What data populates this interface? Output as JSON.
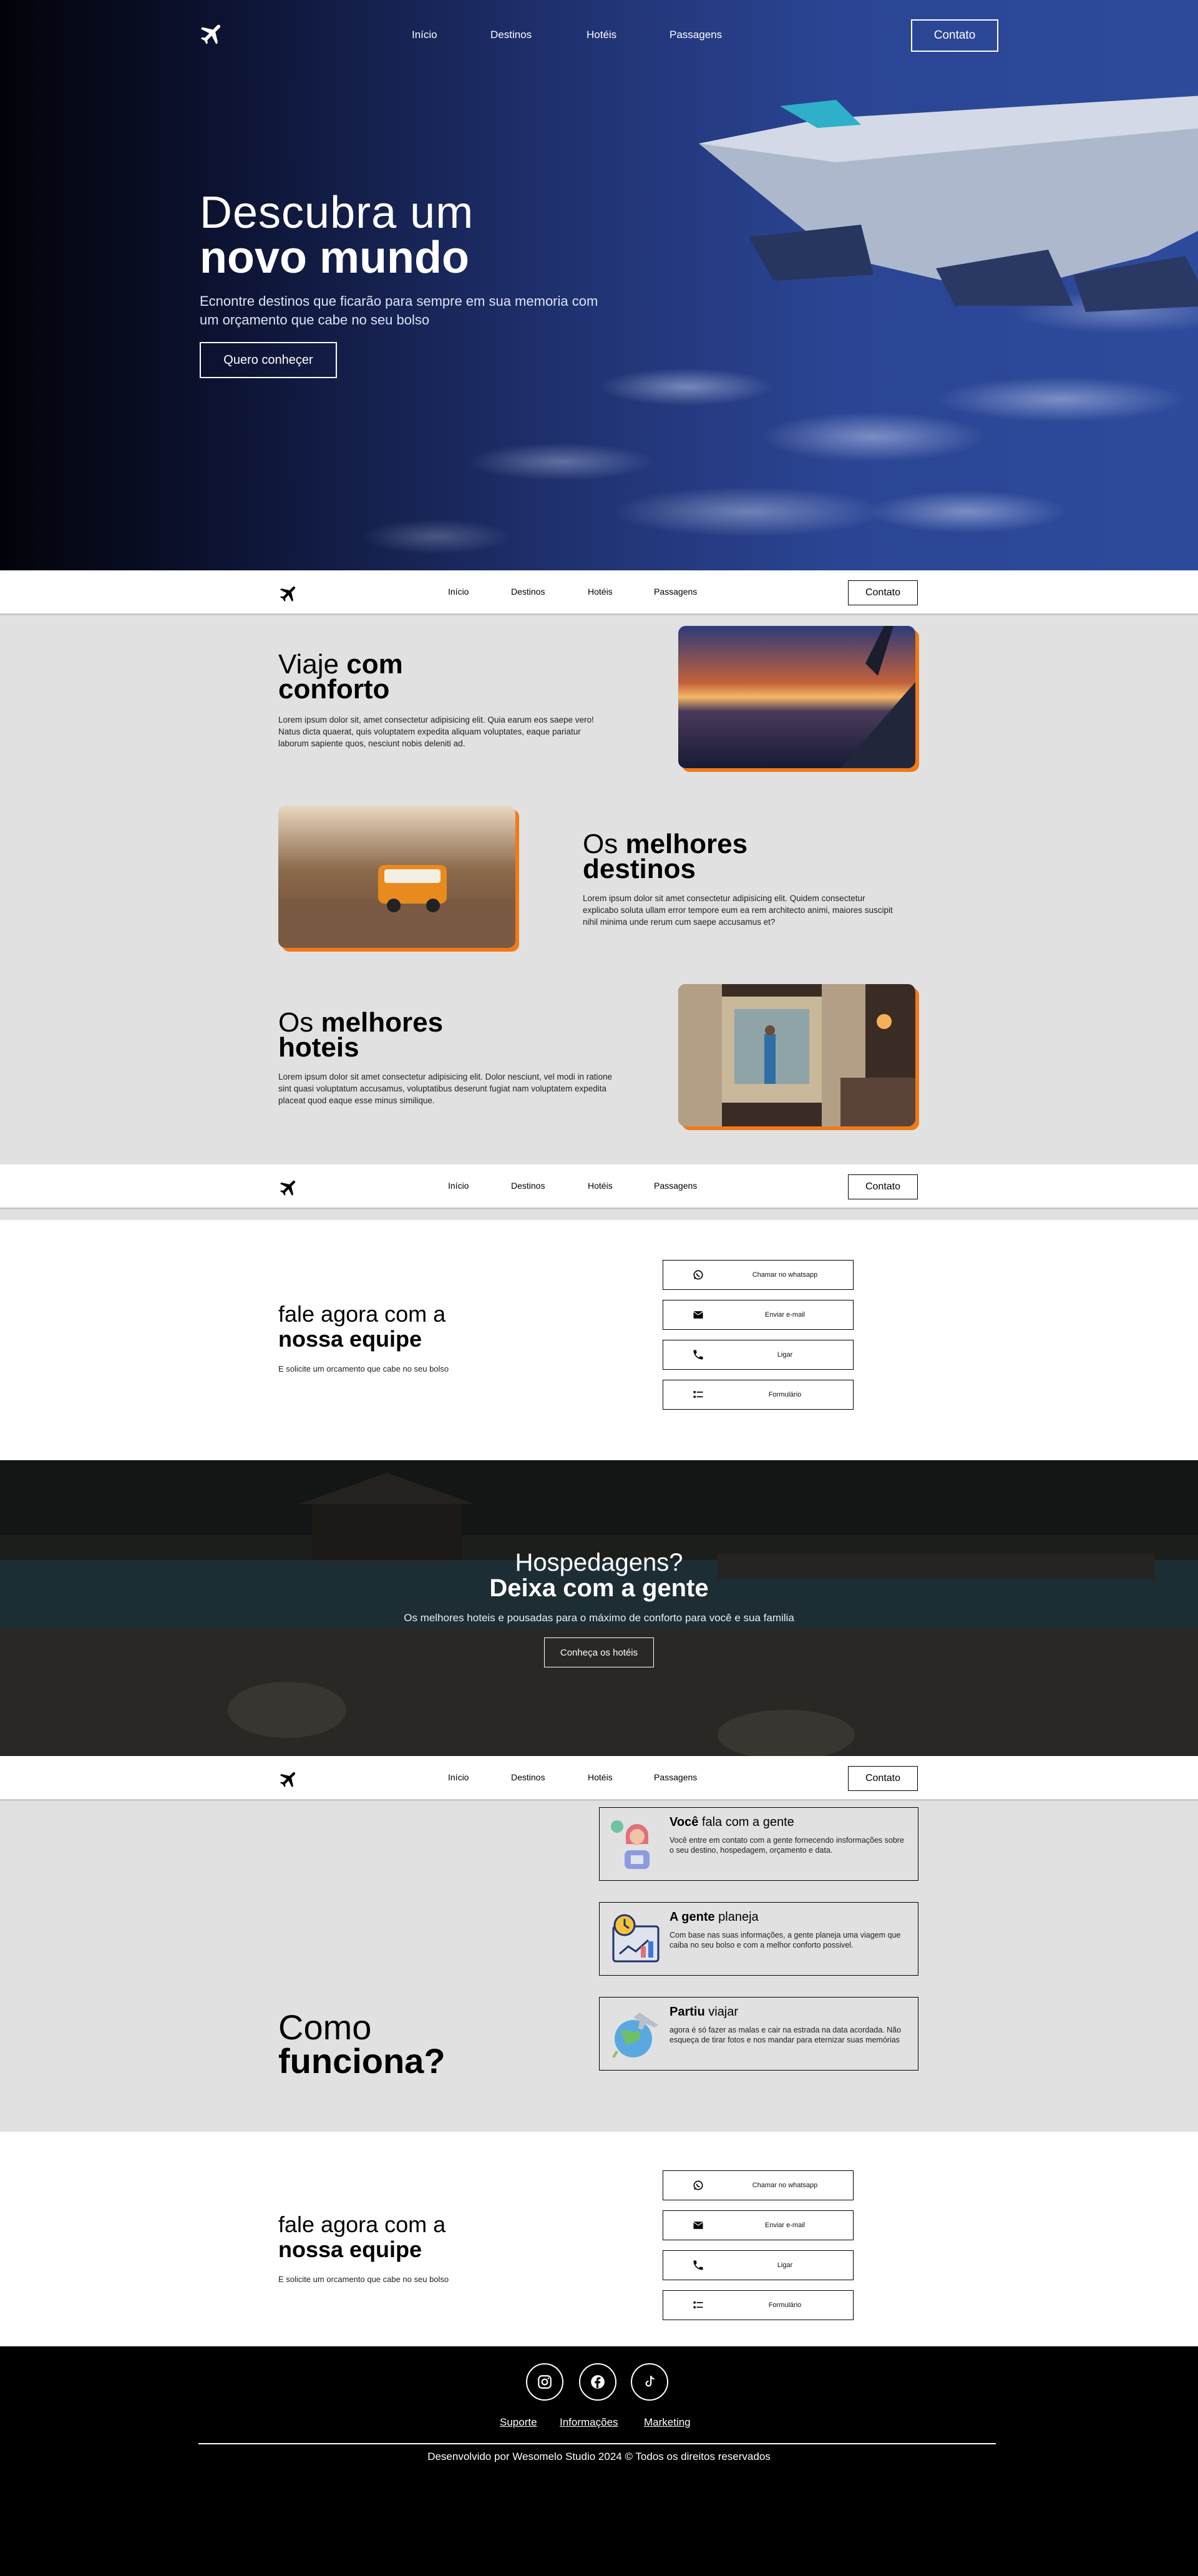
{
  "nav": {
    "links": [
      "Início",
      "Destinos",
      "Hotéis",
      "Passagens"
    ],
    "contact_label": "Contato"
  },
  "hero": {
    "title_light": "Descubra um",
    "title_bold": "novo mundo",
    "subtitle": "Ecnontre destinos que ficarão para sempre em sua memoria com um orçamento que cabe no seu bolso",
    "cta_label": "Quero conheçer"
  },
  "features": [
    {
      "title_light": "Viaje ",
      "title_bold_1": "com",
      "title_bold_2": "conforto",
      "text": "Lorem ipsum dolor sit, amet consectetur adipisicing elit. Quia earum eos saepe vero! Natus dicta quaerat, quis voluptatem expedita aliquam voluptates, eaque pariatur laborum sapiente quos, nesciunt nobis deleniti ad."
    },
    {
      "title_light": "Os ",
      "title_bold_1": "melhores",
      "title_bold_2": "destinos",
      "text": "Lorem ipsum dolor sit amet consectetur adipisicing elit. Quidem consectetur explicabo soluta ullam error tempore eum ea rem architecto animi, maiores suscipit nihil minima unde rerum cum saepe accusamus et?"
    },
    {
      "title_light": "Os ",
      "title_bold_1": "melhores",
      "title_bold_2": "hoteis",
      "text": "Lorem ipsum dolor sit amet consectetur adipisicing elit. Dolor nesciunt, vel modi in ratione sint quasi voluptatum accusamus, voluptatibus deserunt fugiat nam voluptatem expedita placeat quod eaque esse minus similique."
    }
  ],
  "contact": {
    "title_light": "fale agora com a",
    "title_bold": "nossa equipe",
    "subtitle": "E solicite um orcamento que cabe no seu bolso",
    "buttons": [
      "Chamar no whatsapp",
      "Enviar e-mail",
      "Ligar",
      "Formulário"
    ],
    "icons": [
      "whatsapp-icon",
      "email-icon",
      "phone-icon",
      "form-icon"
    ]
  },
  "hotel_banner": {
    "title_light": "Hospedagens?",
    "title_bold": "Deixa com a gente",
    "subtitle": "Os melhores hoteis e pousadas para o máximo de conforto para você e sua familia",
    "cta_label": "Conheça os hotéis"
  },
  "how": {
    "title_light": "Como",
    "title_bold": "funciona?",
    "steps": [
      {
        "bold": "Você",
        "light": " fala com a gente",
        "text": "Você entre em contato com a gente fornecendo insformações sobre o seu destino, hospedagem, orçamento e data."
      },
      {
        "bold": "A gente",
        "light": " planeja",
        "text": "Com base nas suas informações, a gente planeja uma viagem que caiba no seu bolso e com a melhor conforto possivel."
      },
      {
        "bold": "Partiu",
        "light": " viajar",
        "text": "agora é só fazer as malas e cair na estrada na data acordada. Não esqueça de tirar fotos e nos mandar para eternizar suas memórias"
      }
    ]
  },
  "footer": {
    "social": [
      "instagram-icon",
      "facebook-icon",
      "tiktok-icon"
    ],
    "links": [
      "Suporte",
      "Informações",
      "Marketing"
    ],
    "copyright": "Desenvolvido por Wesomelo Studio 2024 © Todos os direitos reservados"
  },
  "colors": {
    "accent": "#f07a1b",
    "section_gray": "#e1e1e1",
    "hero_blue": "#2b4594"
  }
}
